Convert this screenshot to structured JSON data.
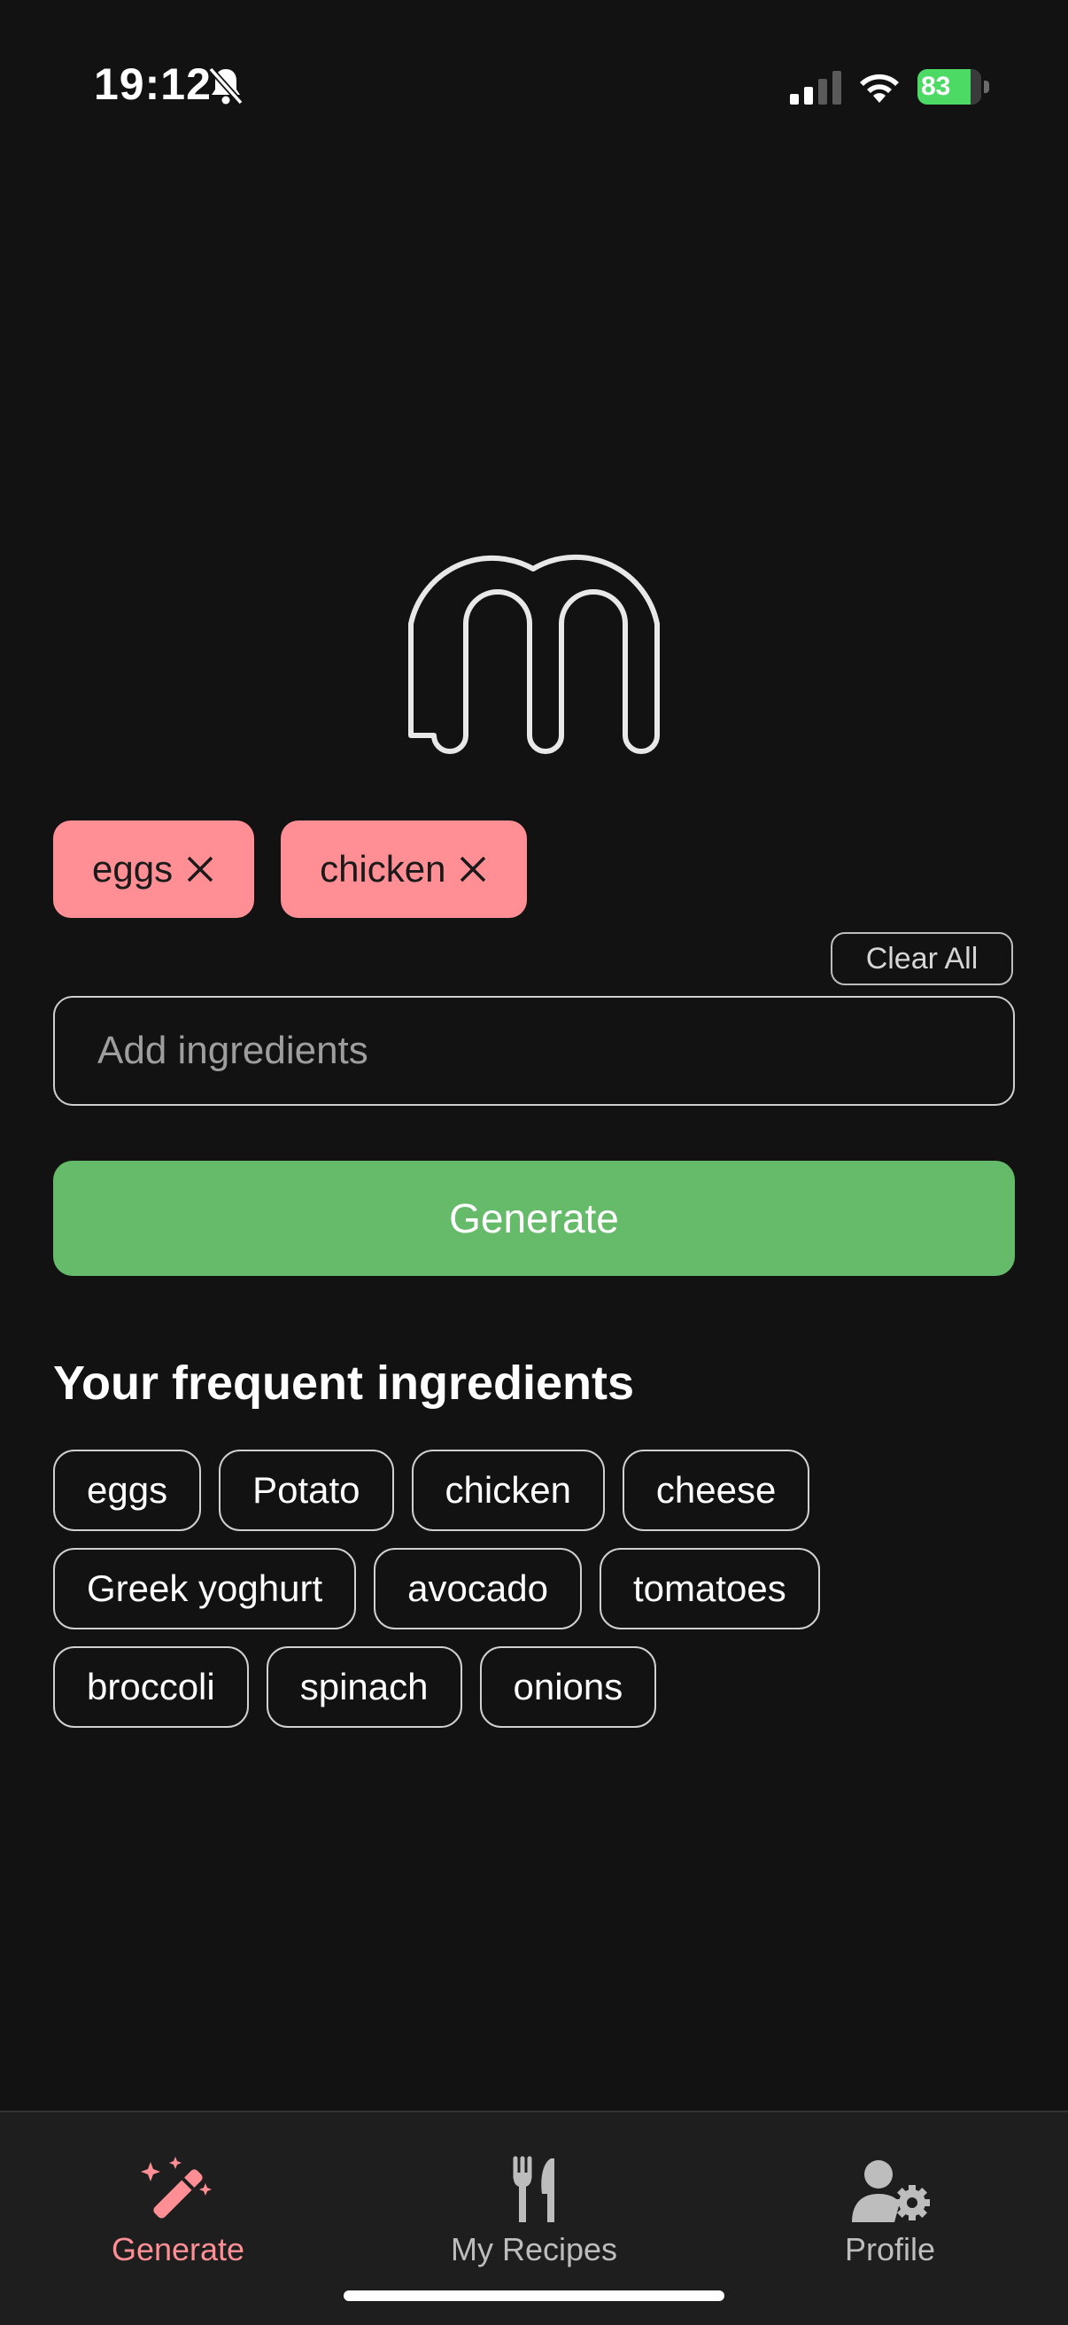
{
  "status_bar": {
    "time": "19:12",
    "battery_level": "83",
    "icons": [
      "bell-slash-icon",
      "cellular-signal-icon",
      "wifi-icon",
      "battery-charging-icon"
    ]
  },
  "colors": {
    "accent_pink": "#ff8f94",
    "generate_green": "#66bb6a",
    "background": "#121212"
  },
  "selected_ingredients": [
    "eggs",
    "chicken"
  ],
  "clear_all_label": "Clear All",
  "input": {
    "placeholder": "Add ingredients",
    "value": ""
  },
  "generate_label": "Generate",
  "frequent": {
    "title": "Your frequent ingredients",
    "rows": [
      [
        "eggs",
        "Potato",
        "chicken",
        "cheese"
      ],
      [
        "Greek yoghurt",
        "avocado",
        "tomatoes"
      ],
      [
        "broccoli",
        "spinach",
        "onions"
      ]
    ]
  },
  "tab_bar": {
    "tabs": [
      {
        "label": "Generate",
        "icon": "magic-wand-icon",
        "active": true
      },
      {
        "label": "My Recipes",
        "icon": "fork-knife-icon",
        "active": false
      },
      {
        "label": "Profile",
        "icon": "user-gear-icon",
        "active": false
      }
    ]
  }
}
